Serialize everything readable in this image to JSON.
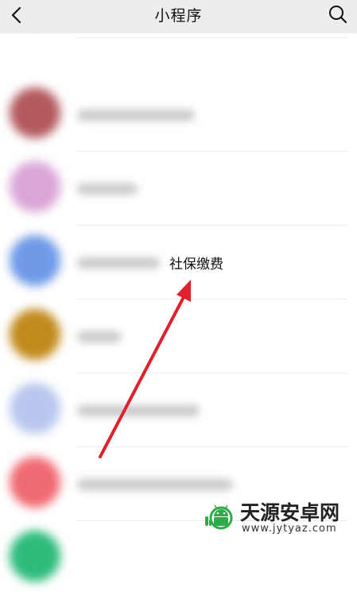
{
  "header": {
    "title": "小程序",
    "back_icon": "chevron-left-icon",
    "search_icon": "search-icon"
  },
  "list": {
    "items": [
      {
        "avatar_color": "#3ed49a"
      },
      {
        "avatar_color": "#b35a5e"
      },
      {
        "avatar_color": "#d9a6d6"
      },
      {
        "avatar_color": "#6f9ae8"
      },
      {
        "avatar_color": "#c28a1c"
      },
      {
        "avatar_color": "#b9c7ee"
      },
      {
        "avatar_color": "#f06a72"
      },
      {
        "avatar_color": "#2dbb7a"
      }
    ]
  },
  "annotation": {
    "label": "社保缴费",
    "arrow_color": "#e0202c"
  },
  "watermark": {
    "title": "天源安卓网",
    "url": "www.jytyaz.com"
  }
}
